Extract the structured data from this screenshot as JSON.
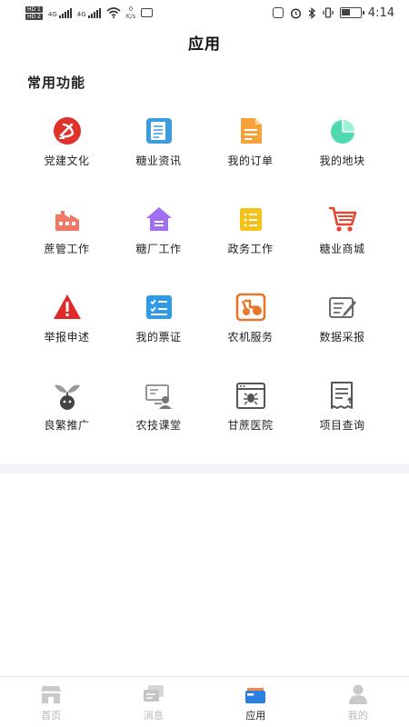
{
  "status_bar": {
    "hd1": "HD 1",
    "hd2": "HD 2",
    "sig1": "4G",
    "sig2": "4G",
    "net_speed": "0",
    "net_unit": "K/s",
    "time": "4:14",
    "battery_level": 0.45
  },
  "header": {
    "title": "应用"
  },
  "section": {
    "title": "常用功能"
  },
  "apps": [
    {
      "label": "党建文化",
      "icon": "party-emblem-icon",
      "color": "#e0322b"
    },
    {
      "label": "糖业资讯",
      "icon": "news-doc-icon",
      "color": "#3d9be0"
    },
    {
      "label": "我的订单",
      "icon": "order-doc-icon",
      "color": "#f5a23a"
    },
    {
      "label": "我的地块",
      "icon": "pie-chart-icon",
      "color": "#4fd9b0"
    },
    {
      "label": "蔗管工作",
      "icon": "factory-icon",
      "color": "#f07866"
    },
    {
      "label": "糖厂工作",
      "icon": "house-icon",
      "color": "#a06ef0"
    },
    {
      "label": "政务工作",
      "icon": "list-doc-icon",
      "color": "#f5c21a"
    },
    {
      "label": "糖业商城",
      "icon": "shopping-cart-icon",
      "color": "#e8442f"
    },
    {
      "label": "举报申述",
      "icon": "warning-triangle-icon",
      "color": "#e02a2a"
    },
    {
      "label": "我的票证",
      "icon": "checklist-icon",
      "color": "#2e9be8"
    },
    {
      "label": "农机服务",
      "icon": "tractor-icon",
      "color": "#e8762a"
    },
    {
      "label": "数据采报",
      "icon": "edit-report-icon",
      "color": "#6b6b6b"
    },
    {
      "label": "良繁推广",
      "icon": "seedling-icon",
      "color": "#444444"
    },
    {
      "label": "农技课堂",
      "icon": "classroom-icon",
      "color": "#888888"
    },
    {
      "label": "甘蔗医院",
      "icon": "hospital-bug-icon",
      "color": "#555555"
    },
    {
      "label": "项目查询",
      "icon": "project-search-icon",
      "color": "#555555"
    }
  ],
  "tabs": [
    {
      "label": "首页",
      "icon": "shop-icon",
      "active": false
    },
    {
      "label": "消息",
      "icon": "message-icon",
      "active": false
    },
    {
      "label": "应用",
      "icon": "apps-icon",
      "active": true
    },
    {
      "label": "我的",
      "icon": "user-icon",
      "active": false
    }
  ],
  "colors": {
    "accent": "#2f7fe0",
    "tab_inactive": "#b8b8b8",
    "band": "#f2f4f7"
  }
}
